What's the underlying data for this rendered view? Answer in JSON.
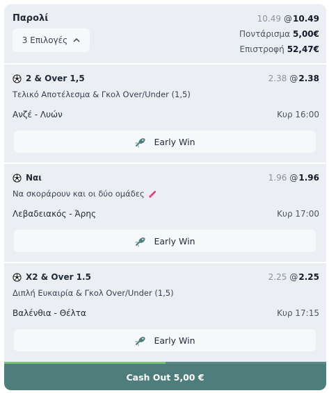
{
  "header": {
    "title": "Παρολί",
    "selections_label": "3 Επιλογές",
    "odds_old": "10.49",
    "odds_at": "@",
    "odds_new": "10.49",
    "stake_label": "Ποντάρισμα",
    "stake_value": "5,00€",
    "return_label": "Επιστροφή",
    "return_value": "52,47€"
  },
  "legs": [
    {
      "selection": "2 & Over 1,5",
      "odds_old": "2.38",
      "odds_at": "@",
      "odds_new": "2.38",
      "market": "Τελικό Αποτέλεσμα & Γκολ Over/Under (1,5)",
      "match": "Ανζέ - Λυών",
      "time": "Κυρ 16:00",
      "early_win_label": "Early Win",
      "boost_icon": false
    },
    {
      "selection": "Ναι",
      "odds_old": "1.96",
      "odds_at": "@",
      "odds_new": "1.96",
      "market": "Να σκοράρουν και οι δύο ομάδες",
      "match": "Λεβαδειακός - Άρης",
      "time": "Κυρ 17:00",
      "early_win_label": "Early Win",
      "boost_icon": true
    },
    {
      "selection": "X2 & Over 1.5",
      "odds_old": "2.25",
      "odds_at": "@",
      "odds_new": "2.25",
      "market": "Διπλή Ευκαιρία & Γκολ Over/Under (1,5)",
      "match": "Βαλένθια - Θέλτα",
      "time": "Κυρ 17:15",
      "early_win_label": "Early Win",
      "boost_icon": false
    }
  ],
  "cashout": {
    "label": "Cash Out 5,00 €",
    "progress": 0.5
  },
  "colors": {
    "card_bg": "#ebeff3",
    "cashout_bg": "#4f7d7c",
    "progress_fill": "#7ac47a",
    "early_win_icon": "#4f7d7c"
  }
}
